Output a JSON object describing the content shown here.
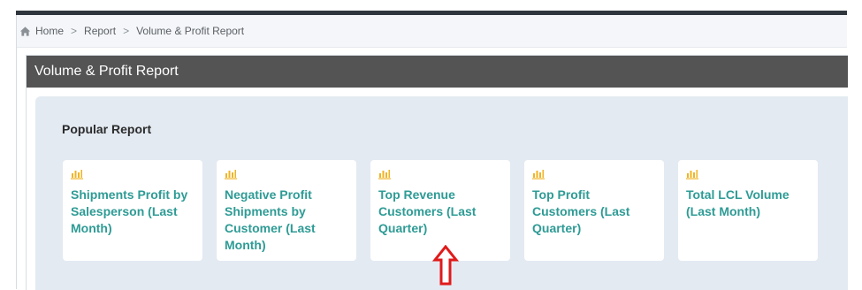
{
  "breadcrumb": {
    "items": [
      {
        "label": "Home",
        "icon": "home-icon"
      },
      {
        "label": "Report"
      },
      {
        "label": "Volume & Profit Report"
      }
    ],
    "separator": ">"
  },
  "panel": {
    "title": "Volume & Profit Report",
    "section_title": "Popular Report",
    "cards": [
      {
        "label": "Shipments Profit by Salesperson (Last Month)",
        "icon": "bar-chart-icon"
      },
      {
        "label": "Negative Profit Shipments by Customer (Last Month)",
        "icon": "bar-chart-icon"
      },
      {
        "label": "Top Revenue Customers (Last Quarter)",
        "icon": "bar-chart-icon"
      },
      {
        "label": "Top Profit Customers (Last Quarter)",
        "icon": "bar-chart-icon"
      },
      {
        "label": "Total LCL Volume (Last Month)",
        "icon": "bar-chart-icon"
      }
    ]
  },
  "annotation": {
    "icon": "up-arrow-icon",
    "color": "#e01a1a"
  },
  "colors": {
    "header_bg": "#545454",
    "body_bg": "#e3eaf2",
    "card_title": "#2e9b95",
    "icon_accent": "#f0b323"
  }
}
